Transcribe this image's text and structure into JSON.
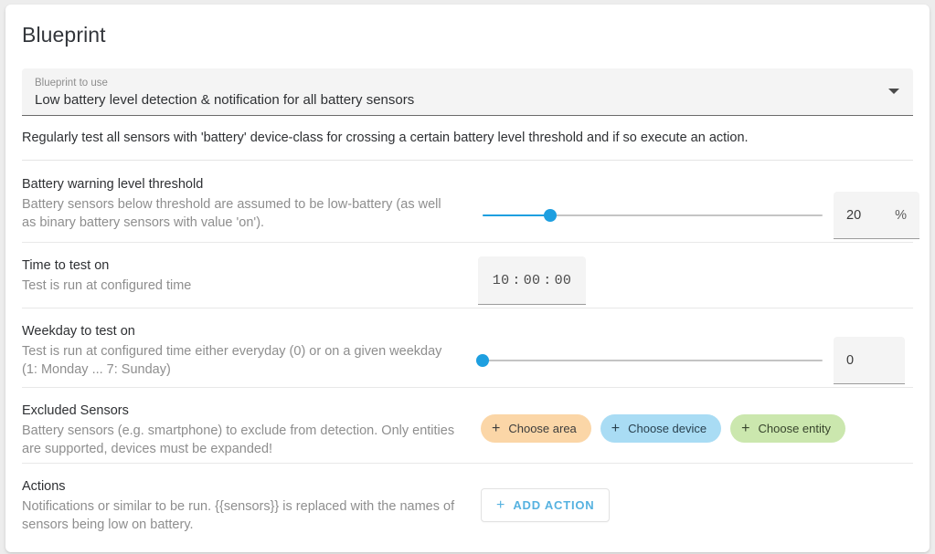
{
  "card": {
    "title": "Blueprint"
  },
  "blueprint_picker": {
    "label": "Blueprint to use",
    "value": "Low battery level detection & notification for all battery sensors",
    "arrow_icon": "chevron-down-icon"
  },
  "blueprint_description": "Regularly test all sensors with 'battery' device-class for crossing a certain battery level threshold and if so execute an action.",
  "rows": [
    {
      "name": "Battery warning level threshold",
      "description": "Battery sensors below threshold are assumed to be low-battery (as well as binary battery sensors with value 'on').",
      "slider": {
        "value": 20,
        "min": 0,
        "max": 100
      },
      "value": "20",
      "unit": "%"
    },
    {
      "name": "Time to test on",
      "description": "Test is run at configured time",
      "time": {
        "hours": "10",
        "minutes": "00",
        "seconds": "00",
        "separator": ":"
      }
    },
    {
      "name": "Weekday to test on",
      "description": "Test is run at configured time either everyday (0) or on a given weekday (1: Monday ... 7: Sunday)",
      "slider": {
        "value": 0,
        "min": 0,
        "max": 7
      },
      "value": "0"
    },
    {
      "name": "Excluded Sensors",
      "description": "Battery sensors (e.g. smartphone) to exclude from detection. Only entities are supported, devices must be expanded!",
      "chips": [
        {
          "label": "Choose area",
          "icon": "plus-icon",
          "color": "#fbd6a7"
        },
        {
          "label": "Choose device",
          "icon": "plus-icon",
          "color": "#a9dcf4"
        },
        {
          "label": "Choose entity",
          "icon": "plus-icon",
          "color": "#cbe7ae"
        }
      ]
    },
    {
      "name": "Actions",
      "description": "Notifications or similar to be run. {{sensors}} is replaced with the names of sensors being low on battery.",
      "button": {
        "label": "ADD ACTION",
        "icon": "plus-icon"
      }
    }
  ],
  "colors": {
    "accent": "#1e9fe0",
    "button_text": "#56b2e0",
    "card_bg": "#ffffff",
    "field_bg": "#f4f4f4",
    "page_bg": "#ededed"
  }
}
